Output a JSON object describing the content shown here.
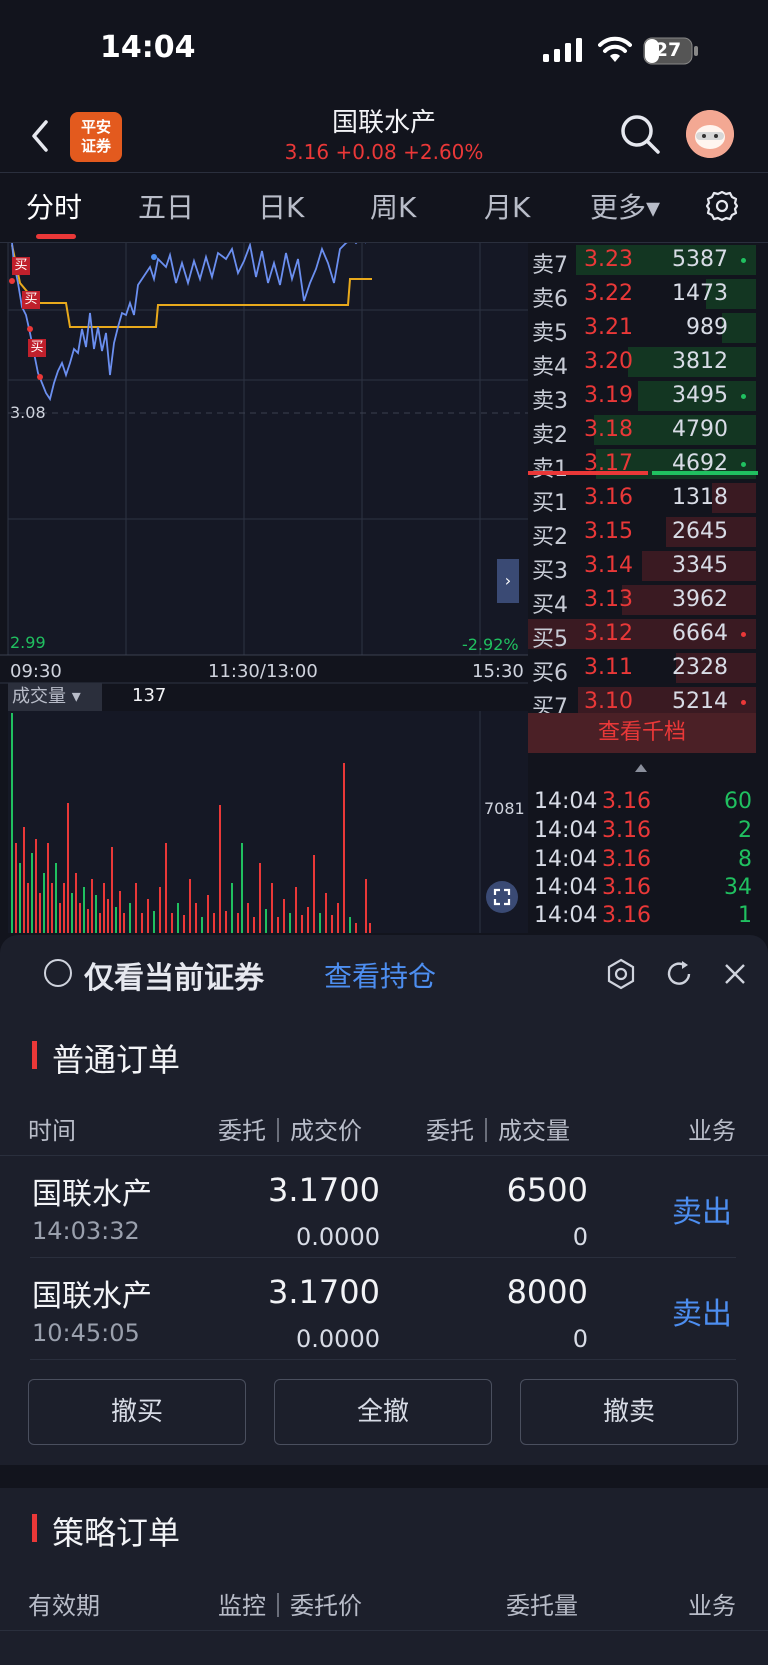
{
  "status_bar": {
    "time": "14:04",
    "battery": "27"
  },
  "header": {
    "logo_line1": "平安",
    "logo_line2": "证券",
    "name": "国联水产",
    "quote": "3.16 +0.08 +2.60%"
  },
  "tabs": [
    "分时",
    "五日",
    "日K",
    "周K",
    "月K",
    "更多▾"
  ],
  "chart": {
    "price_label_mid": "3.08",
    "price_low": "2.99",
    "pct_low": "-2.92%",
    "time_open": "09:30",
    "time_mid": "11:30/13:00",
    "time_close": "15:30",
    "trade_marker": "买",
    "volume_label": "成交量 ▾",
    "volume_value": "137",
    "volume_max": "7081"
  },
  "order_book": {
    "asks": [
      {
        "label": "卖7",
        "price": "3.23",
        "volume": "5387"
      },
      {
        "label": "卖6",
        "price": "3.22",
        "volume": "1473"
      },
      {
        "label": "卖5",
        "price": "3.21",
        "volume": "989"
      },
      {
        "label": "卖4",
        "price": "3.20",
        "volume": "3812"
      },
      {
        "label": "卖3",
        "price": "3.19",
        "volume": "3495"
      },
      {
        "label": "卖2",
        "price": "3.18",
        "volume": "4790"
      },
      {
        "label": "卖1",
        "price": "3.17",
        "volume": "4692"
      }
    ],
    "bids": [
      {
        "label": "买1",
        "price": "3.16",
        "volume": "1318"
      },
      {
        "label": "买2",
        "price": "3.15",
        "volume": "2645"
      },
      {
        "label": "买3",
        "price": "3.14",
        "volume": "3345"
      },
      {
        "label": "买4",
        "price": "3.13",
        "volume": "3962"
      },
      {
        "label": "买5",
        "price": "3.12",
        "volume": "6664"
      },
      {
        "label": "买6",
        "price": "3.11",
        "volume": "2328"
      },
      {
        "label": "买7",
        "price": "3.10",
        "volume": "5214"
      }
    ],
    "view_thousand": "查看千档",
    "ticks": [
      {
        "time": "14:04",
        "price": "3.16",
        "volume": "60"
      },
      {
        "time": "14:04",
        "price": "3.16",
        "volume": "2"
      },
      {
        "time": "14:04",
        "price": "3.16",
        "volume": "8"
      },
      {
        "time": "14:04",
        "price": "3.16",
        "volume": "34"
      },
      {
        "time": "14:04",
        "price": "3.16",
        "volume": "1"
      }
    ]
  },
  "panel": {
    "only_current": "仅看当前证券",
    "view_holdings": "查看持仓",
    "normal_orders": {
      "title": "普通订单",
      "headers": [
        "时间",
        "委托｜成交价",
        "委托｜成交量",
        "业务"
      ],
      "rows": [
        {
          "name": "国联水产",
          "time": "14:03:32",
          "order_price": "3.1700",
          "fill_price": "0.0000",
          "order_qty": "6500",
          "fill_qty": "0",
          "action": "卖出"
        },
        {
          "name": "国联水产",
          "time": "10:45:05",
          "order_price": "3.1700",
          "fill_price": "0.0000",
          "order_qty": "8000",
          "fill_qty": "0",
          "action": "卖出"
        }
      ],
      "buttons": [
        "撤买",
        "全撤",
        "撤卖"
      ]
    },
    "strategy_orders": {
      "title": "策略订单",
      "headers": [
        "有效期",
        "监控｜委托价",
        "委托量",
        "业务"
      ]
    }
  }
}
